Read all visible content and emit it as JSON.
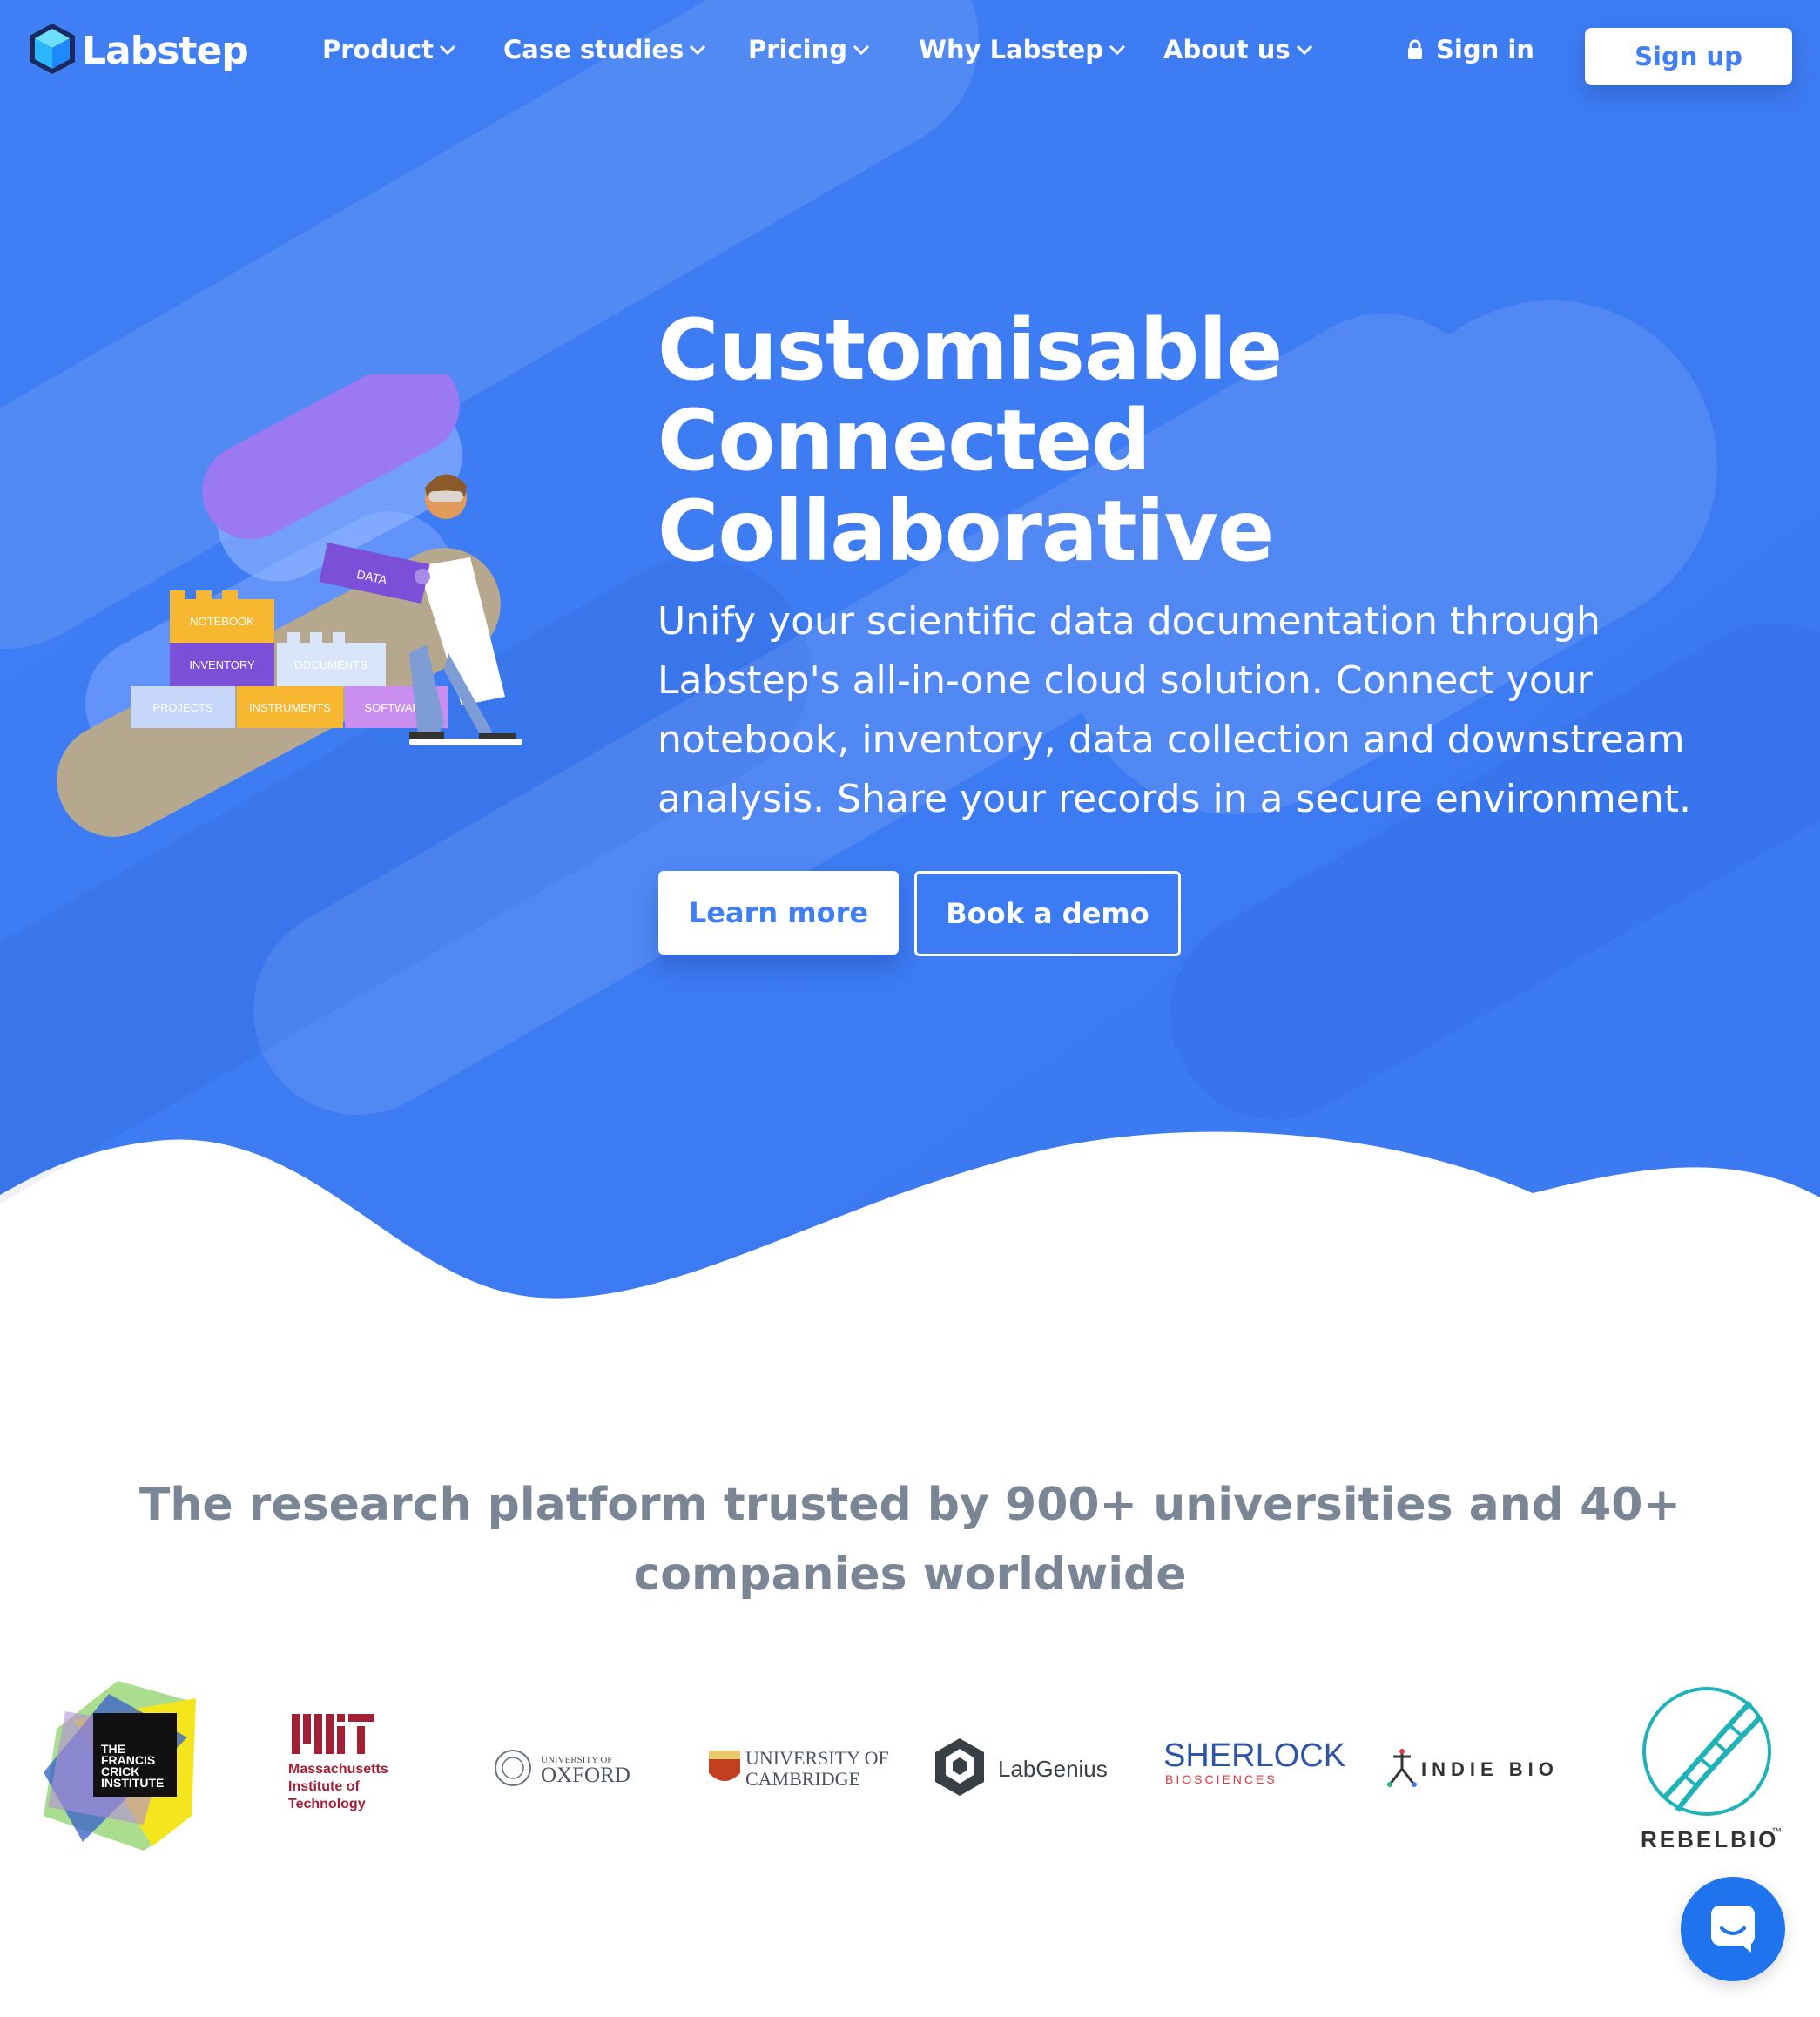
{
  "nav": {
    "logo_text": "Labstep",
    "items": [
      {
        "label": "Product"
      },
      {
        "label": "Case studies"
      },
      {
        "label": "Pricing"
      },
      {
        "label": "Why Labstep"
      },
      {
        "label": "About us"
      }
    ],
    "signin": "Sign in",
    "signup": "Sign up"
  },
  "hero": {
    "headline": [
      "Customisable",
      "Connected",
      "Collaborative"
    ],
    "subtext": "Unify your scientific data documentation through Labstep's all-in-one cloud solution. Connect your notebook, inventory, data collection and downstream analysis. Share your records in a secure environment.",
    "learn_more": "Learn more",
    "book_demo": "Book a demo"
  },
  "illustration": {
    "blocks": [
      "NOTEBOOK",
      "INVENTORY",
      "DOCUMENTS",
      "PROJECTS",
      "INSTRUMENTS",
      "SOFTWARE"
    ],
    "box_label": "DATA"
  },
  "trusted": {
    "heading": "The research platform trusted by 900+ universities and 40+ companies worldwide"
  },
  "logos": {
    "crick": [
      "THE",
      "FRANCIS",
      "CRICK",
      "INSTITUTE"
    ],
    "mit": [
      "Massachusetts",
      "Institute of",
      "Technology"
    ],
    "oxford_small": "UNIVERSITY OF",
    "oxford_big": "OXFORD",
    "cambridge": [
      "UNIVERSITY OF",
      "CAMBRIDGE"
    ],
    "labgenius": "LabGenius",
    "sherlock": "SHERLOCK",
    "sherlock_sub": "BIOSCIENCES",
    "indiebio": "INDIE BIO",
    "rebelbio": "REBELBIO",
    "rebelbio_tm": "™"
  },
  "colors": {
    "hero_blue": "#3f7ef4",
    "button_text": "#3f7ef4",
    "heading_grey": "#7a8595",
    "chat_blue": "#1f73ec"
  },
  "icons": [
    "labstep-cube-icon",
    "chevron-down-icon",
    "lock-icon",
    "chat-icon"
  ]
}
